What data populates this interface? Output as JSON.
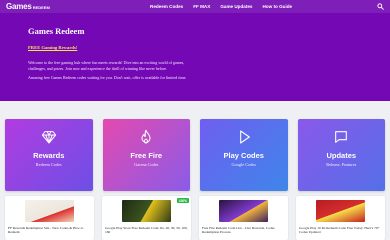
{
  "brand": {
    "name": "Games",
    "sub": "REDEEM"
  },
  "nav": {
    "items": [
      "Redeem Codes",
      "FF MAX",
      "Game Updates",
      "How to Guide"
    ]
  },
  "hero": {
    "title": "Games Redeem",
    "link": "FREE Gaming Rewards!",
    "p1": "Welcome to the free gaming hub where fun meets rewards! Dive into an exciting world of games, challenges, and prizes. Join now and experience the thrill of winning like never before.",
    "p2": "Amazing free Games Redeem codes waiting for you. Don't wait, offer is available for limited time."
  },
  "cards": [
    {
      "title": "Rewards",
      "sub": "Redeem Codes",
      "icon": "diamond-icon"
    },
    {
      "title": "Free Fire",
      "sub": "Garena Codes",
      "icon": "flame-icon"
    },
    {
      "title": "Play Codes",
      "sub": "Google Codes",
      "icon": "play-icon"
    },
    {
      "title": "Updates",
      "sub": "Release, Features",
      "icon": "chat-icon"
    }
  ],
  "articles": [
    {
      "title": "FF Rewards Redemption Site - New Codes & How to Redeem"
    },
    {
      "title": "Google Play Store Free Redeem Code: Rs. 20, 30, 50, 100, 160",
      "badge": "100%"
    },
    {
      "title": "Free Fire Redeem Code List - Live Rewards, Codes Redemption Process"
    },
    {
      "title": "Google Play 10 Rs Redeem Code Free Today: Here's 70+ Codes Updated"
    }
  ],
  "colors": {
    "header": "#7f1fb9",
    "hero": "#7408b5",
    "accent_link": "#ffe14a"
  }
}
